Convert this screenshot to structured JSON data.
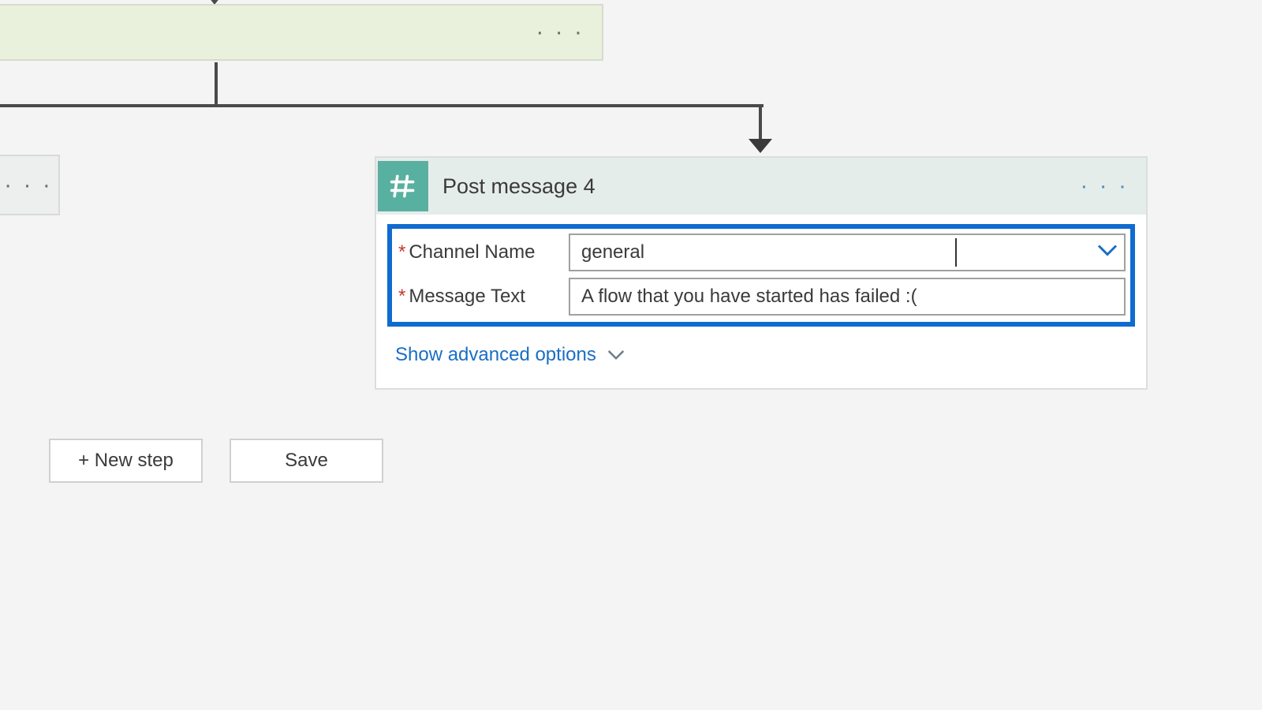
{
  "prev_step_ellipsis": "· · ·",
  "left_block_ellipsis": "· · ·",
  "action": {
    "title": "Post message 4",
    "ellipsis": "· · ·",
    "fields": {
      "channel": {
        "label": "Channel Name",
        "value": "general"
      },
      "message": {
        "label": "Message Text",
        "value": "A flow that you have started has failed :("
      }
    },
    "advanced_label": "Show advanced options"
  },
  "buttons": {
    "new_step": "+ New step",
    "save": "Save"
  }
}
